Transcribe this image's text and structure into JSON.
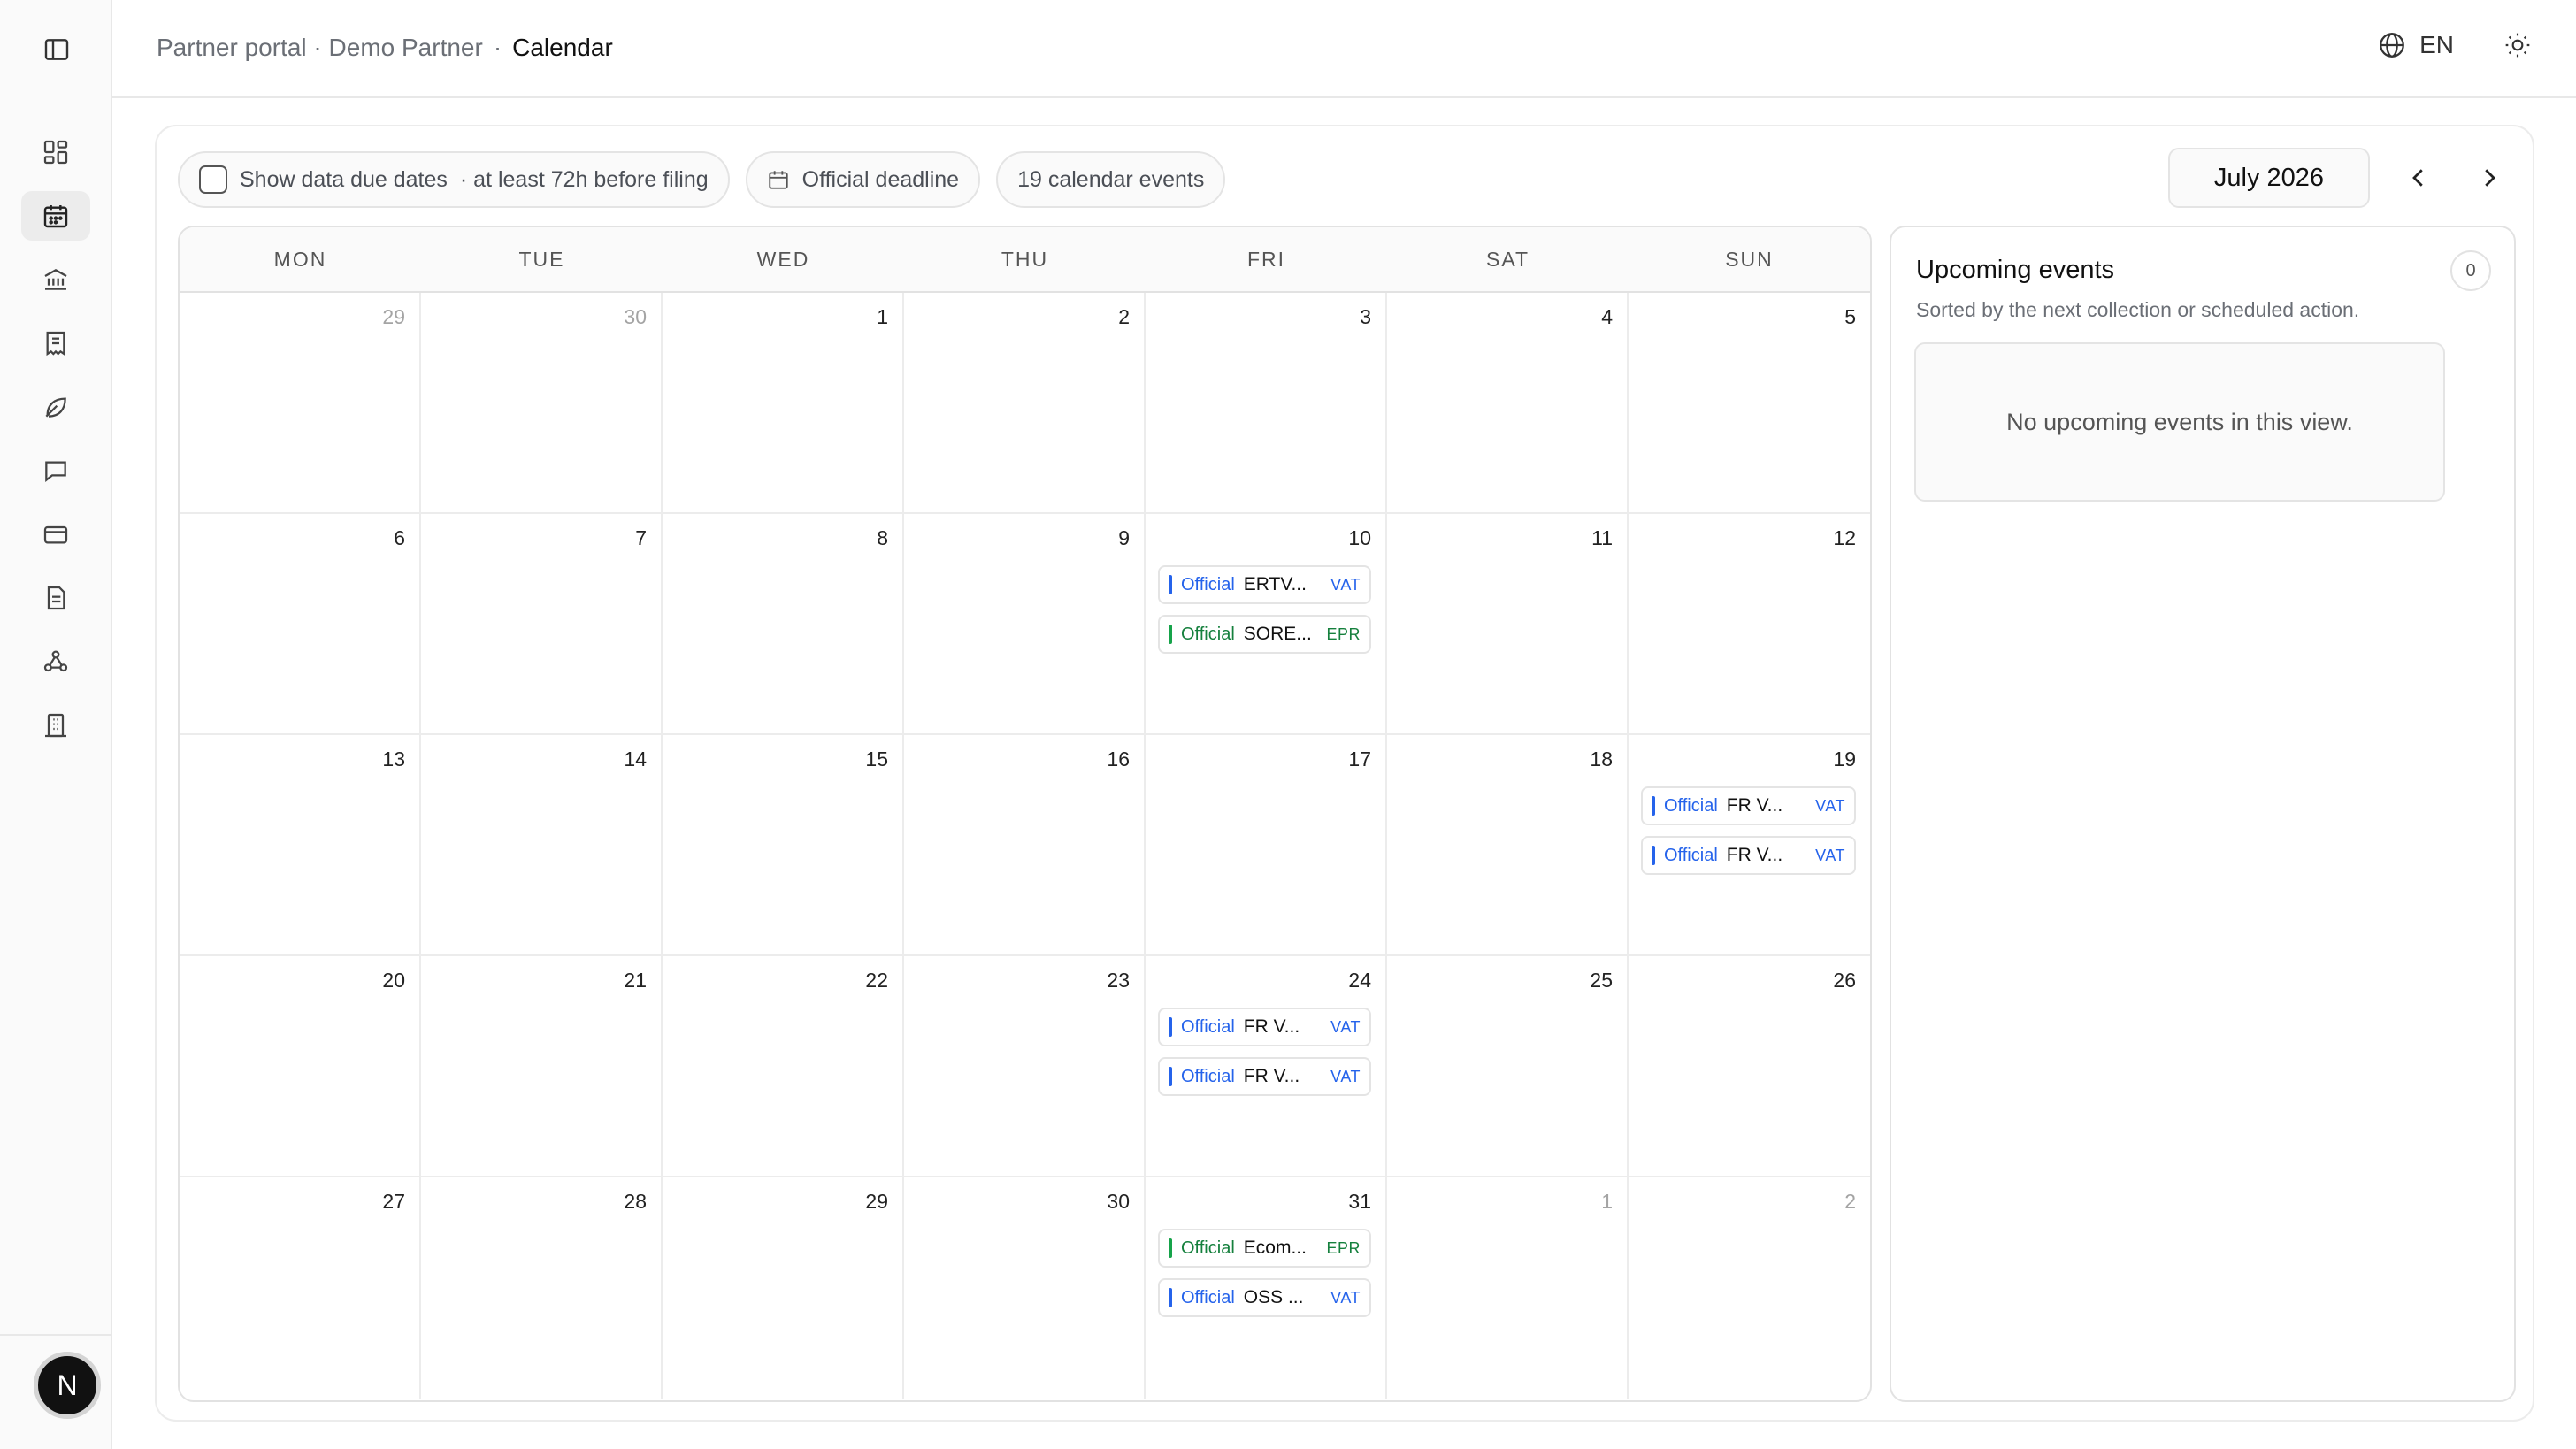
{
  "breadcrumb": {
    "portal": "Partner portal · Demo Partner",
    "separator": "·",
    "current": "Calendar"
  },
  "header": {
    "language": "EN"
  },
  "sidebar": {
    "items": [
      {
        "icon": "dashboard-icon",
        "active": false
      },
      {
        "icon": "calendar-icon",
        "active": true
      },
      {
        "icon": "bank-icon",
        "active": false
      },
      {
        "icon": "receipt-icon",
        "active": false
      },
      {
        "icon": "leaf-icon",
        "active": false
      },
      {
        "icon": "message-icon",
        "active": false
      },
      {
        "icon": "credit-card-icon",
        "active": false
      },
      {
        "icon": "document-icon",
        "active": false
      },
      {
        "icon": "webhook-icon",
        "active": false
      },
      {
        "icon": "building-icon",
        "active": false
      }
    ],
    "avatar_initial": "N"
  },
  "toolbar": {
    "show_due_label": "Show data due dates",
    "show_due_hint": "· at least 72h before filing",
    "official_deadline": "Official deadline",
    "events_count": "19 calendar events"
  },
  "month": {
    "label": "July 2026"
  },
  "calendar": {
    "weekdays": [
      "MON",
      "TUE",
      "WED",
      "THU",
      "FRI",
      "SAT",
      "SUN"
    ],
    "days": [
      {
        "n": "29",
        "muted": true
      },
      {
        "n": "30",
        "muted": true
      },
      {
        "n": "1"
      },
      {
        "n": "2"
      },
      {
        "n": "3"
      },
      {
        "n": "4"
      },
      {
        "n": "5"
      },
      {
        "n": "6"
      },
      {
        "n": "7"
      },
      {
        "n": "8"
      },
      {
        "n": "9"
      },
      {
        "n": "10",
        "events": [
          {
            "kind": "Official",
            "title": "ERTV...",
            "tag": "VAT",
            "type": "vat"
          },
          {
            "kind": "Official",
            "title": "SORE...",
            "tag": "EPR",
            "type": "epr"
          }
        ]
      },
      {
        "n": "11"
      },
      {
        "n": "12"
      },
      {
        "n": "13"
      },
      {
        "n": "14"
      },
      {
        "n": "15"
      },
      {
        "n": "16"
      },
      {
        "n": "17"
      },
      {
        "n": "18"
      },
      {
        "n": "19",
        "events": [
          {
            "kind": "Official",
            "title": "FR V...",
            "tag": "VAT",
            "type": "vat"
          },
          {
            "kind": "Official",
            "title": "FR V...",
            "tag": "VAT",
            "type": "vat"
          }
        ]
      },
      {
        "n": "20"
      },
      {
        "n": "21"
      },
      {
        "n": "22"
      },
      {
        "n": "23"
      },
      {
        "n": "24",
        "events": [
          {
            "kind": "Official",
            "title": "FR V...",
            "tag": "VAT",
            "type": "vat"
          },
          {
            "kind": "Official",
            "title": "FR V...",
            "tag": "VAT",
            "type": "vat"
          }
        ]
      },
      {
        "n": "25"
      },
      {
        "n": "26"
      },
      {
        "n": "27"
      },
      {
        "n": "28"
      },
      {
        "n": "29"
      },
      {
        "n": "30"
      },
      {
        "n": "31",
        "events": [
          {
            "kind": "Official",
            "title": "Ecom...",
            "tag": "EPR",
            "type": "epr"
          },
          {
            "kind": "Official",
            "title": "OSS ...",
            "tag": "VAT",
            "type": "vat"
          }
        ]
      },
      {
        "n": "1",
        "muted": true
      },
      {
        "n": "2",
        "muted": true
      }
    ]
  },
  "upcoming": {
    "title": "Upcoming events",
    "subtitle": "Sorted by the next collection or scheduled action.",
    "count": "0",
    "empty": "No upcoming events in this view."
  },
  "colors": {
    "vat": "#2563eb",
    "epr": "#15803d"
  }
}
